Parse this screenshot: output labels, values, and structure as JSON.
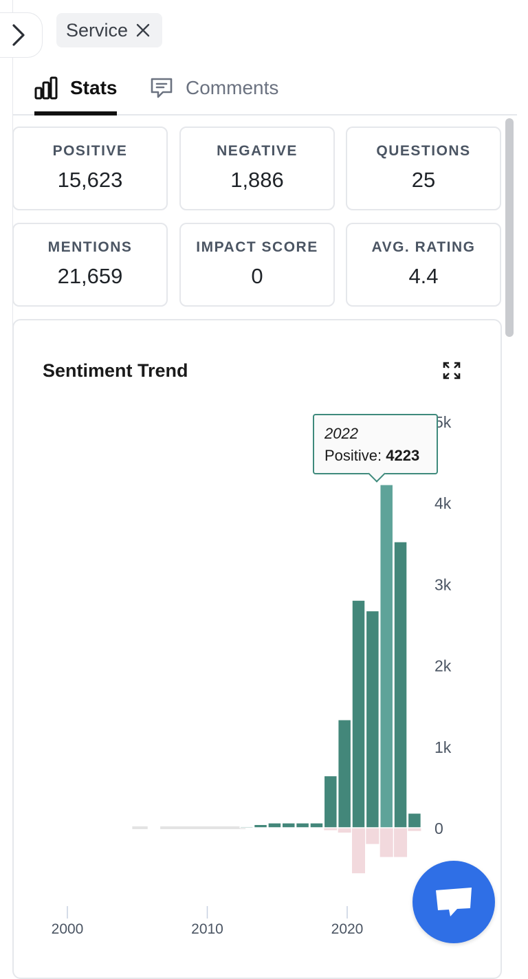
{
  "filter": {
    "chip_label": "Service"
  },
  "tabs": {
    "stats": "Stats",
    "comments": "Comments"
  },
  "stats": [
    {
      "label": "POSITIVE",
      "value": "15,623"
    },
    {
      "label": "NEGATIVE",
      "value": "1,886"
    },
    {
      "label": "QUESTIONS",
      "value": "25"
    },
    {
      "label": "MENTIONS",
      "value": "21,659"
    },
    {
      "label": "IMPACT SCORE",
      "value": "0"
    },
    {
      "label": "AVG. RATING",
      "value": "4.4"
    }
  ],
  "chart": {
    "title": "Sentiment Trend"
  },
  "tooltip": {
    "year": "2022",
    "series_label": "Positive:",
    "value": "4223"
  },
  "chart_data": {
    "type": "bar",
    "title": "Sentiment Trend",
    "x_ticks": [
      "2000",
      "2010",
      "2020"
    ],
    "y_ticks": [
      "0",
      "1k",
      "2k",
      "3k",
      "4k",
      "5k"
    ],
    "ylim": [
      -600,
      5000
    ],
    "colors": {
      "positive": "#43877a",
      "positive_hover": "#5ea399",
      "negative": "#f2d9dd",
      "neutral": "#e3e3e3"
    },
    "series": [
      {
        "name": "Positive",
        "x": [
          2012,
          2013,
          2014,
          2015,
          2016,
          2017,
          2018,
          2019,
          2020,
          2021,
          2022,
          2023,
          2024
        ],
        "values": [
          15,
          40,
          60,
          60,
          60,
          60,
          640,
          1330,
          2800,
          2670,
          4223,
          3520,
          180
        ]
      },
      {
        "name": "Negative",
        "x": [
          2018,
          2019,
          2020,
          2021,
          2022,
          2023,
          2024
        ],
        "values": [
          -30,
          -60,
          -560,
          -200,
          -360,
          -360,
          -40
        ]
      }
    ],
    "neutral_segments": [
      [
        2004,
        2005
      ],
      [
        2006,
        2012
      ]
    ],
    "highlight": {
      "x": 2022,
      "series": "Positive",
      "value": 4223
    },
    "grid": false,
    "legend": "none"
  }
}
